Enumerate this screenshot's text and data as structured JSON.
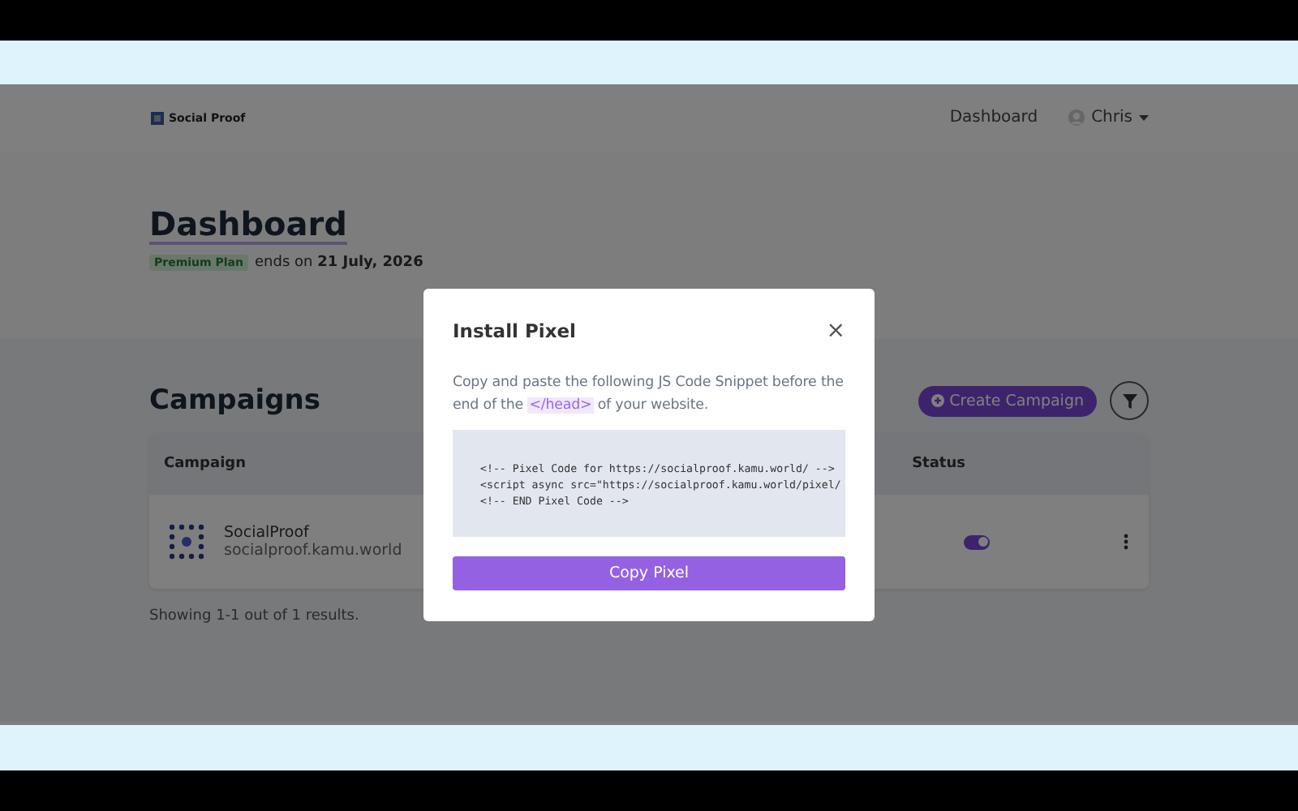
{
  "navbar": {
    "brand": "Social Proof",
    "links": [
      "Dashboard"
    ],
    "user": "Chris"
  },
  "header": {
    "title": "Dashboard",
    "plan_badge": "Premium Plan",
    "plan_text": "ends on ",
    "plan_date": "21 July, 2026"
  },
  "campaigns": {
    "title": "Campaigns",
    "create_button": "Create Campaign",
    "columns": [
      "Campaign",
      "Status"
    ],
    "rows": [
      {
        "name": "SocialProof",
        "domain": "socialproof.kamu.world",
        "on": true
      }
    ],
    "footer": "Showing 1-1 out of 1 results."
  },
  "modal": {
    "title": "Install Pixel",
    "close": "×",
    "text_before": "Copy and paste the following JS Code Snippet before the end of the ",
    "tag": "</head>",
    "text_after": " of your website.",
    "code": [
      "<!-- Pixel Code for https://socialproof.kamu.world/ -->",
      "<script async src=\"https://socialproof.kamu.world/pixel/",
      "<!-- END Pixel Code -->"
    ],
    "button": "Copy Pixel"
  }
}
